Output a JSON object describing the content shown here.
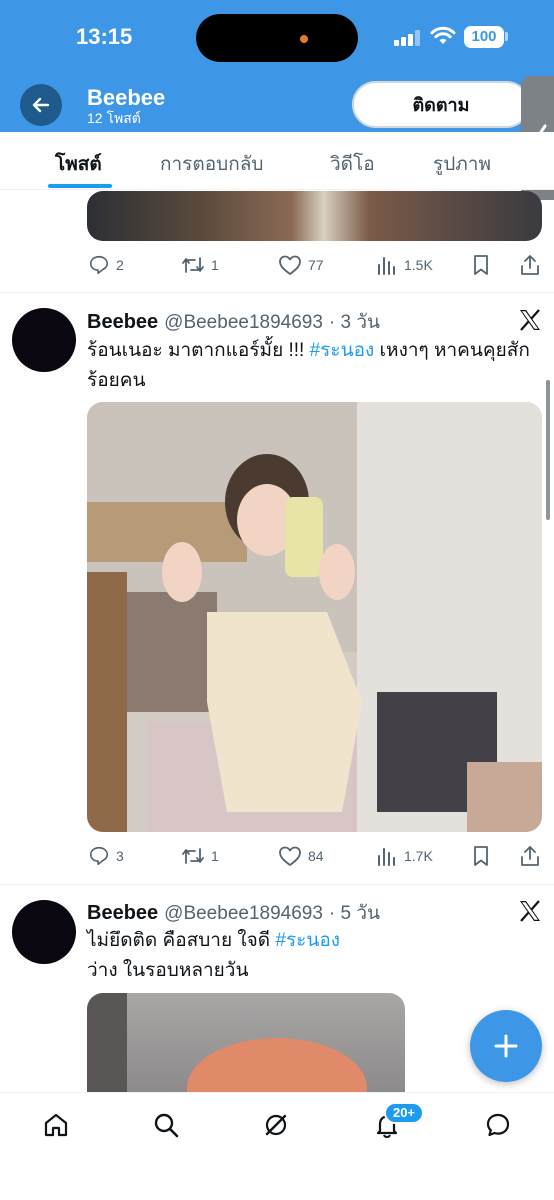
{
  "status_bar": {
    "time": "13:15",
    "battery": "100"
  },
  "header": {
    "name": "Beebee",
    "post_count": "12 โพสต์",
    "follow_label": "ติดตาม"
  },
  "tabs": [
    {
      "label": "โพสต์",
      "active": true
    },
    {
      "label": "การตอบกลับ",
      "active": false
    },
    {
      "label": "วิดีโอ",
      "active": false
    },
    {
      "label": "รูปภาพ",
      "active": false
    }
  ],
  "partial_tweet": {
    "replies": "2",
    "reposts": "1",
    "likes": "77",
    "views": "1.5K"
  },
  "tweets": [
    {
      "name": "Beebee",
      "handle": "@Beebee1894693",
      "time": "· 3 วัน",
      "text_before": "ร้อนเนอะ มาตากแอร์มั้ย !!! ",
      "hashtag": "#ระนอง",
      "text_after": " เหงาๆ หาคนคุยสักร้อยคน",
      "replies": "3",
      "reposts": "1",
      "likes": "84",
      "views": "1.7K"
    },
    {
      "name": "Beebee",
      "handle": "@Beebee1894693",
      "time": "· 5 วัน",
      "text_before": "ไม่ยึดติด คือสบาย ใจดี  ",
      "hashtag": "#ระนอง",
      "text_after": "",
      "line2": "ว่าง ในรอบหลายวัน"
    }
  ],
  "bottom_nav": {
    "notifications_badge": "20+"
  },
  "colors": {
    "accent": "#1d9bf0",
    "header": "#3d97e6",
    "muted": "#536471"
  }
}
